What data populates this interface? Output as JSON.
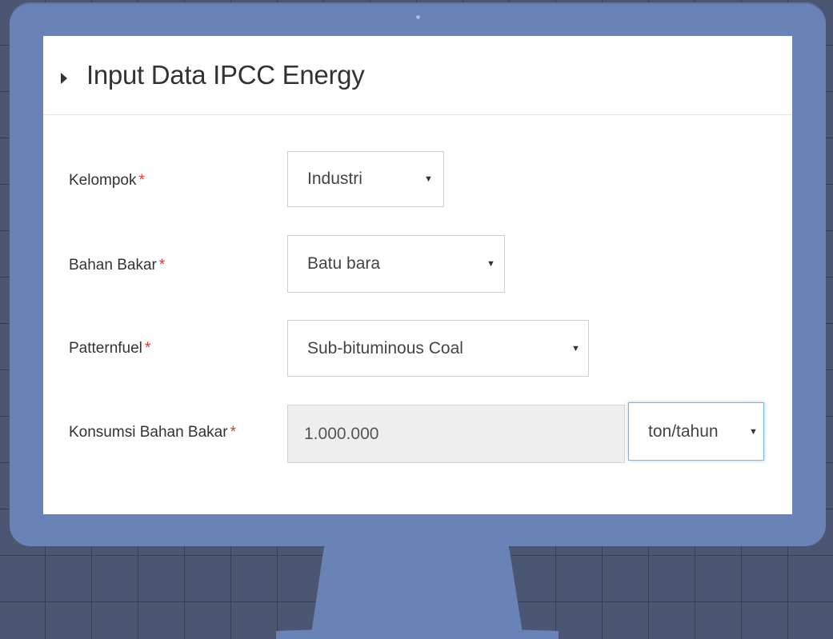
{
  "colors": {
    "monitor_frame": "#6a83b6",
    "background": "#4a5672",
    "required_marker": "#e0392b",
    "focus_border": "#7cb6e4"
  },
  "panel": {
    "title": "Input Data IPCC Energy",
    "icon": "caret-right-icon"
  },
  "form": {
    "required_marker": "*",
    "kelompok": {
      "label": "Kelompok",
      "value": "Industri"
    },
    "bahan_bakar": {
      "label": "Bahan Bakar",
      "value": "Batu bara"
    },
    "patternfuel": {
      "label": "Patternfuel",
      "value": "Sub-bituminous Coal"
    },
    "konsumsi": {
      "label": "Konsumsi Bahan Bakar",
      "value": "1.000.000",
      "unit": "ton/tahun"
    },
    "dropdown_arrow": "▼"
  }
}
